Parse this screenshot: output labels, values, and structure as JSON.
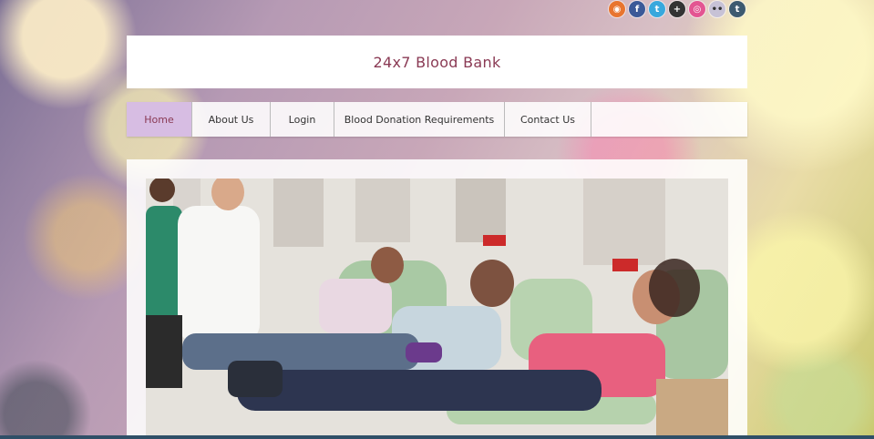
{
  "site": {
    "title": "24x7 Blood Bank"
  },
  "social": [
    {
      "name": "rss-icon",
      "glyph": "◉",
      "color": "#e8752f"
    },
    {
      "name": "facebook-icon",
      "glyph": "f",
      "color": "#3b5998"
    },
    {
      "name": "twitter-icon",
      "glyph": "t",
      "color": "#38a8dd"
    },
    {
      "name": "plus-icon",
      "glyph": "+",
      "color": "#333333"
    },
    {
      "name": "dribbble-icon",
      "glyph": "◎",
      "color": "#e35592"
    },
    {
      "name": "flickr-icon",
      "glyph": "••",
      "color": "#c7c2d6"
    },
    {
      "name": "tumblr-icon",
      "glyph": "t",
      "color": "#3d5a70"
    }
  ],
  "nav": {
    "items": [
      "Home",
      "About Us",
      "Login",
      "Blood Donation Requirements",
      "Contact Us"
    ],
    "active": "Home"
  },
  "hero": {
    "image": "blood-donation-photo"
  }
}
